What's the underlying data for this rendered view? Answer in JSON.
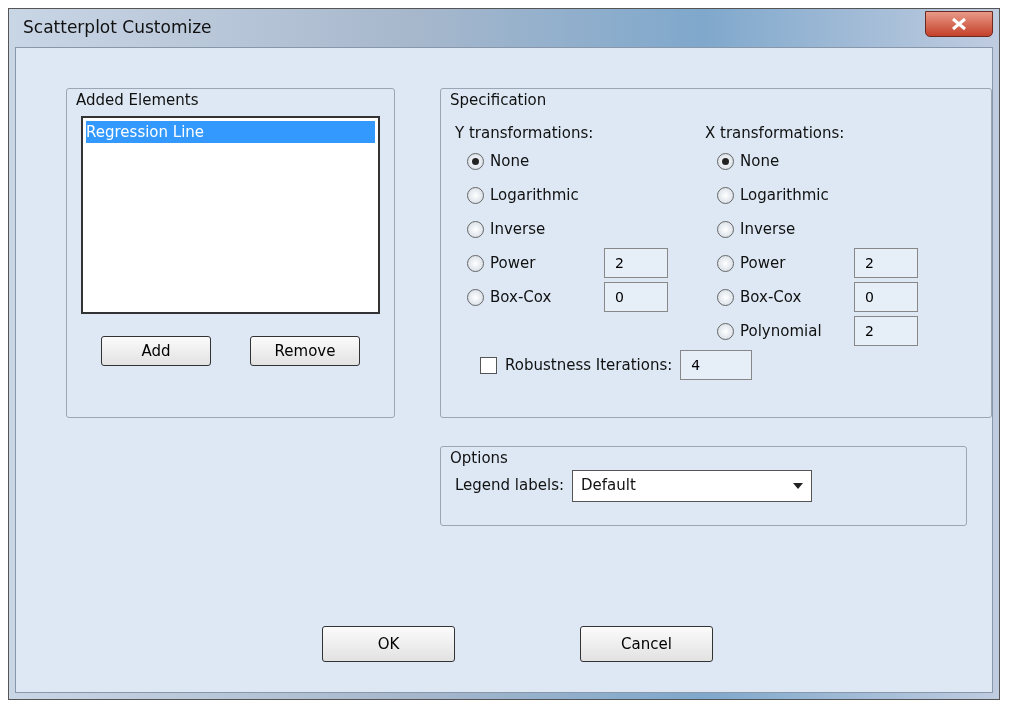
{
  "window": {
    "title": "Scatterplot Customize"
  },
  "added_elements": {
    "label": "Added Elements",
    "items": [
      {
        "text": "Regression Line",
        "selected": true
      }
    ],
    "buttons": [
      "Add",
      "Remove"
    ]
  },
  "specification": {
    "label": "Specification",
    "y": {
      "heading": "Y transformations:",
      "options": [
        {
          "label": "None",
          "selected": true
        },
        {
          "label": "Logarithmic",
          "selected": false
        },
        {
          "label": "Inverse",
          "selected": false
        },
        {
          "label": "Power",
          "selected": false,
          "value": "2"
        },
        {
          "label": "Box-Cox",
          "selected": false,
          "value": "0"
        }
      ]
    },
    "x": {
      "heading": "X transformations:",
      "options": [
        {
          "label": "None",
          "selected": true
        },
        {
          "label": "Logarithmic",
          "selected": false
        },
        {
          "label": "Inverse",
          "selected": false
        },
        {
          "label": "Power",
          "selected": false,
          "value": "2"
        },
        {
          "label": "Box-Cox",
          "selected": false,
          "value": "0"
        },
        {
          "label": "Polynomial",
          "selected": false,
          "value": "2"
        }
      ]
    },
    "robustness": {
      "label": "Robustness Iterations:",
      "checked": false,
      "value": "4"
    }
  },
  "options": {
    "label": "Options",
    "legend_label": "Legend labels:",
    "legend_value": "Default"
  },
  "buttons": [
    "OK",
    "Cancel"
  ]
}
